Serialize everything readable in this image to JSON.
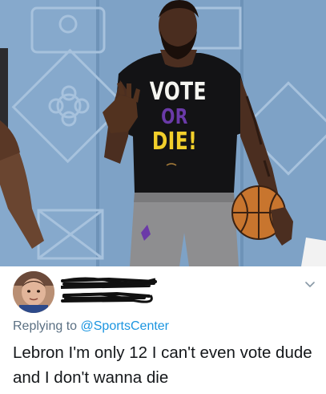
{
  "photo": {
    "shirt_lines": {
      "vote": "VOTE",
      "or": "OR",
      "die": "DIE!"
    },
    "icons": {
      "basketball": "basketball-icon"
    }
  },
  "tweet": {
    "replying_prefix": "Replying to ",
    "replying_handle": "@SportsCenter",
    "text": "Lebron I'm only 12 I can't even vote dude and I don't wanna die",
    "icons": {
      "more": "chevron-down-icon"
    },
    "colors": {
      "handle": "#1b95e0",
      "secondary_text": "#5b7083",
      "primary_text": "#14171a"
    }
  }
}
